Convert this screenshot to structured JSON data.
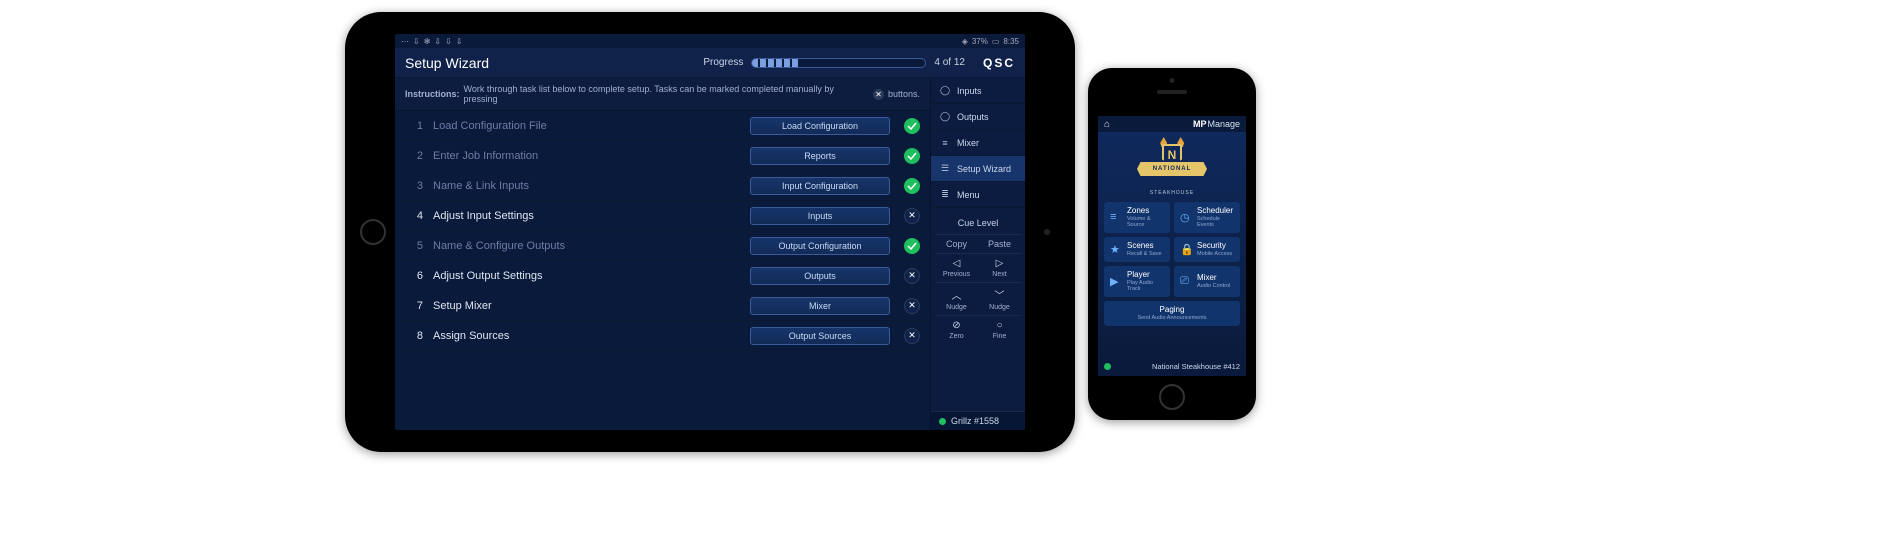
{
  "ipad": {
    "status": {
      "battery": "37%",
      "time": "8:35",
      "wifi": "●"
    },
    "title": "Setup Wizard",
    "progress": {
      "label": "Progress",
      "count": "4 of 12",
      "pct": 27
    },
    "brand": "QSC",
    "instructions": {
      "label": "Instructions:",
      "text": "Work through task list below to complete setup.  Tasks can be marked completed manually by pressing",
      "after": "buttons."
    },
    "tasks": [
      {
        "n": "1",
        "label": "Load Configuration File",
        "button": "Load Configuration",
        "done": true,
        "dim": true
      },
      {
        "n": "2",
        "label": "Enter Job Information",
        "button": "Reports",
        "done": true,
        "dim": true
      },
      {
        "n": "3",
        "label": "Name & Link Inputs",
        "button": "Input Configuration",
        "done": true,
        "dim": true
      },
      {
        "n": "4",
        "label": "Adjust Input Settings",
        "button": "Inputs",
        "done": false,
        "dim": false
      },
      {
        "n": "5",
        "label": "Name & Configure Outputs",
        "button": "Output Configuration",
        "done": true,
        "dim": true
      },
      {
        "n": "6",
        "label": "Adjust Output Settings",
        "button": "Outputs",
        "done": false,
        "dim": false
      },
      {
        "n": "7",
        "label": "Setup Mixer",
        "button": "Mixer",
        "done": false,
        "dim": false
      },
      {
        "n": "8",
        "label": "Assign Sources",
        "button": "Output Sources",
        "done": false,
        "dim": false
      }
    ],
    "nav": [
      {
        "label": "Inputs",
        "icon": "◯"
      },
      {
        "label": "Outputs",
        "icon": "◯"
      },
      {
        "label": "Mixer",
        "icon": "≡"
      },
      {
        "label": "Setup Wizard",
        "icon": "☰",
        "active": true
      },
      {
        "label": "Menu",
        "icon": "≣"
      }
    ],
    "controls": {
      "cue": "Cue Level",
      "copy": "Copy",
      "paste": "Paste",
      "prev": "Previous",
      "next": "Next",
      "nudge": "Nudge",
      "zero": "Zero",
      "fine": "Fine"
    },
    "session": "Grillz #1558"
  },
  "phone": {
    "app": {
      "prefix": "MP",
      "name": "Manage"
    },
    "logo": {
      "initial": "N",
      "top": "NATIONAL",
      "bottom": "STEAKHOUSE"
    },
    "tiles": [
      {
        "icon": "≡",
        "title": "Zones",
        "sub": "Volume & Source"
      },
      {
        "icon": "◷",
        "title": "Scheduler",
        "sub": "Schedule Events"
      },
      {
        "icon": "★",
        "title": "Scenes",
        "sub": "Recall & Save"
      },
      {
        "icon": "🔒",
        "title": "Security",
        "sub": "Mobile Access"
      },
      {
        "icon": "▶",
        "title": "Player",
        "sub": "Play Audio Track"
      },
      {
        "icon": "⎚",
        "title": "Mixer",
        "sub": "Audio Control"
      }
    ],
    "paging": {
      "title": "Paging",
      "sub": "Send Audio Announcements"
    },
    "footer": "National Steakhouse #412"
  }
}
